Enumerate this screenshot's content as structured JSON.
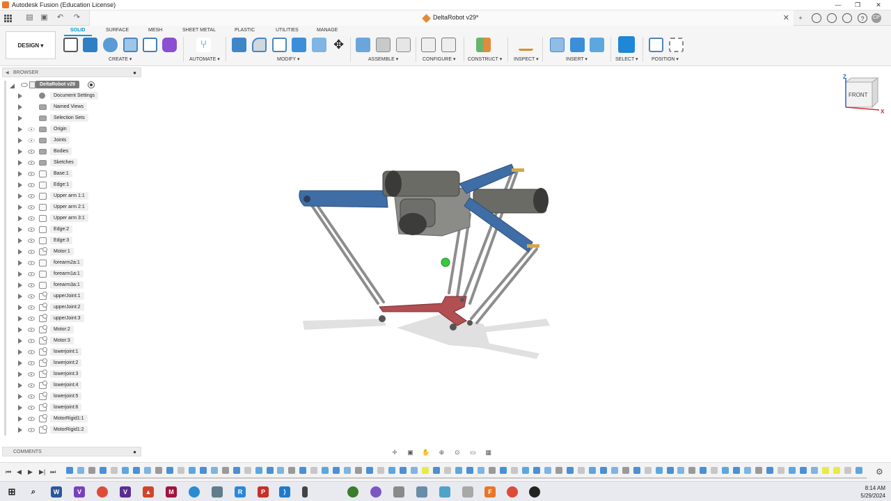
{
  "window": {
    "title": "Autodesk Fusion (Education License)"
  },
  "document_tab": {
    "title": "DeltaRobot v29*"
  },
  "user": {
    "initials": "CP"
  },
  "workspace": {
    "design_label": "DESIGN"
  },
  "ribbon": {
    "tabs": [
      "SOLID",
      "SURFACE",
      "MESH",
      "SHEET METAL",
      "PLASTIC",
      "UTILITIES",
      "MANAGE"
    ],
    "active_tab": "SOLID",
    "groups": [
      "CREATE",
      "AUTOMATE",
      "MODIFY",
      "ASSEMBLE",
      "CONFIGURE",
      "CONSTRUCT",
      "INSPECT",
      "INSERT",
      "SELECT",
      "POSITION"
    ]
  },
  "browser": {
    "header": "BROWSER",
    "root": "DeltaRobot v29",
    "items": [
      {
        "label": "Document Settings",
        "icon": "gear-icon",
        "eye": "none"
      },
      {
        "label": "Named Views",
        "icon": "folder-icon",
        "eye": "none"
      },
      {
        "label": "Selection Sets",
        "icon": "folder-icon",
        "eye": "none"
      },
      {
        "label": "Origin",
        "icon": "folder-icon",
        "eye": "faint"
      },
      {
        "label": "Joints",
        "icon": "folder-icon",
        "eye": "faint"
      },
      {
        "label": "Bodies",
        "icon": "folder-icon",
        "eye": "visible"
      },
      {
        "label": "Sketches",
        "icon": "folder-icon",
        "eye": "visible"
      },
      {
        "label": "Base:1",
        "icon": "component-icon",
        "eye": "visible"
      },
      {
        "label": "Edge:1",
        "icon": "component-icon",
        "eye": "visible"
      },
      {
        "label": "Upper arm 1:1",
        "icon": "component-icon",
        "eye": "visible"
      },
      {
        "label": "Upper arm 2:1",
        "icon": "component-icon",
        "eye": "visible"
      },
      {
        "label": "Upper arm 3:1",
        "icon": "component-icon",
        "eye": "visible"
      },
      {
        "label": "Edge:2",
        "icon": "component-icon",
        "eye": "visible"
      },
      {
        "label": "Edge:3",
        "icon": "component-icon",
        "eye": "visible"
      },
      {
        "label": "Motor:1",
        "icon": "linked-component-icon",
        "eye": "visible"
      },
      {
        "label": "forearm2a:1",
        "icon": "component-icon",
        "eye": "visible"
      },
      {
        "label": "forearm1a:1",
        "icon": "component-icon",
        "eye": "visible"
      },
      {
        "label": "forearm3a:1",
        "icon": "component-icon",
        "eye": "visible"
      },
      {
        "label": "upperJoint:1",
        "icon": "linked-component-icon",
        "eye": "visible"
      },
      {
        "label": "upperJoint:2",
        "icon": "linked-component-icon",
        "eye": "visible"
      },
      {
        "label": "upperJoint:3",
        "icon": "linked-component-icon",
        "eye": "visible"
      },
      {
        "label": "Motor:2",
        "icon": "linked-component-icon",
        "eye": "visible"
      },
      {
        "label": "Motor:3",
        "icon": "linked-component-icon",
        "eye": "visible"
      },
      {
        "label": "lowerjoint:1",
        "icon": "linked-component-icon",
        "eye": "visible"
      },
      {
        "label": "lowerjoint:2",
        "icon": "linked-component-icon",
        "eye": "visible"
      },
      {
        "label": "lowerjoint:3",
        "icon": "linked-component-icon",
        "eye": "visible"
      },
      {
        "label": "lowerjoint:4",
        "icon": "linked-component-icon",
        "eye": "visible"
      },
      {
        "label": "lowerjoint:5",
        "icon": "linked-component-icon",
        "eye": "visible"
      },
      {
        "label": "lowerjoint:6",
        "icon": "linked-component-icon",
        "eye": "visible"
      },
      {
        "label": "MotorRigid1:1",
        "icon": "linked-component-icon",
        "eye": "visible"
      },
      {
        "label": "MotorRigid1:2",
        "icon": "linked-component-icon",
        "eye": "visible"
      }
    ]
  },
  "comments": {
    "header": "COMMENTS"
  },
  "viewcube": {
    "face": "FRONT",
    "axis_z": "Z",
    "axis_x": "X"
  },
  "clock": {
    "time": "8:14 AM",
    "date": "5/29/2024"
  },
  "colors": {
    "accent": "#0696d7",
    "upper_arm": "#3f6ea6",
    "effector": "#b14f52",
    "motor": "#6b6b66"
  }
}
